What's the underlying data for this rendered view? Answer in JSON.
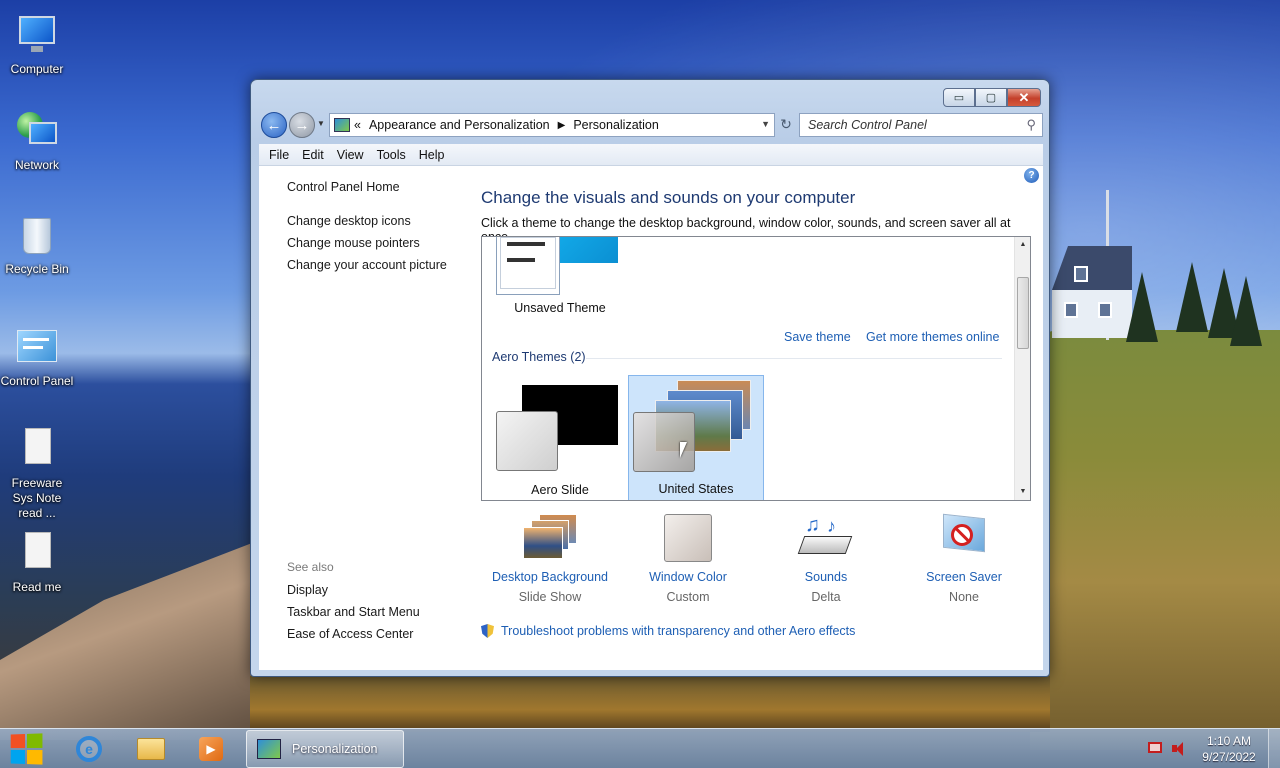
{
  "desktop": {
    "icons": [
      {
        "label": "Computer",
        "icon": "computer-icon"
      },
      {
        "label": "Network",
        "icon": "network-icon"
      },
      {
        "label": "Recycle Bin",
        "icon": "recycle-bin-icon"
      },
      {
        "label": "Control Panel",
        "icon": "control-panel-icon"
      },
      {
        "label": "Freeware Sys Note read ...",
        "icon": "document-icon"
      },
      {
        "label": "Read me",
        "icon": "document-icon"
      }
    ]
  },
  "window": {
    "caption_buttons": {
      "minimize": "▭",
      "maximize": "▢",
      "close": "✕"
    },
    "address": {
      "chevron": "«",
      "crumb1": "Appearance and Personalization",
      "crumb2": "Personalization"
    },
    "search_placeholder": "Search Control Panel",
    "menu": [
      "File",
      "Edit",
      "View",
      "Tools",
      "Help"
    ],
    "sidebar": {
      "home": "Control Panel Home",
      "links": [
        "Change desktop icons",
        "Change mouse pointers",
        "Change your account picture"
      ],
      "see_also_header": "See also",
      "see_also": [
        "Display",
        "Taskbar and Start Menu",
        "Ease of Access Center"
      ]
    },
    "main": {
      "title": "Change the visuals and sounds on your computer",
      "subtitle": "Click a theme to change the desktop background, window color, sounds, and screen saver all at once.",
      "unsaved_theme": "Unsaved Theme",
      "save_theme": "Save theme",
      "more_themes": "Get more themes online",
      "aero_header": "Aero Themes (2)",
      "themes": [
        {
          "label": "Aero Slide",
          "selected": false
        },
        {
          "label": "United States",
          "selected": true
        }
      ],
      "bottom": [
        {
          "label": "Desktop Background",
          "sub": "Slide Show",
          "icon": "desktop-background-icon"
        },
        {
          "label": "Window Color",
          "sub": "Custom",
          "icon": "window-color-icon"
        },
        {
          "label": "Sounds",
          "sub": "Delta",
          "icon": "sounds-icon"
        },
        {
          "label": "Screen Saver",
          "sub": "None",
          "icon": "screen-saver-icon"
        }
      ],
      "troubleshoot": "Troubleshoot problems with transparency and other Aero effects"
    }
  },
  "taskbar": {
    "task_label": "Personalization",
    "time": "1:10 AM",
    "date": "9/27/2022"
  }
}
